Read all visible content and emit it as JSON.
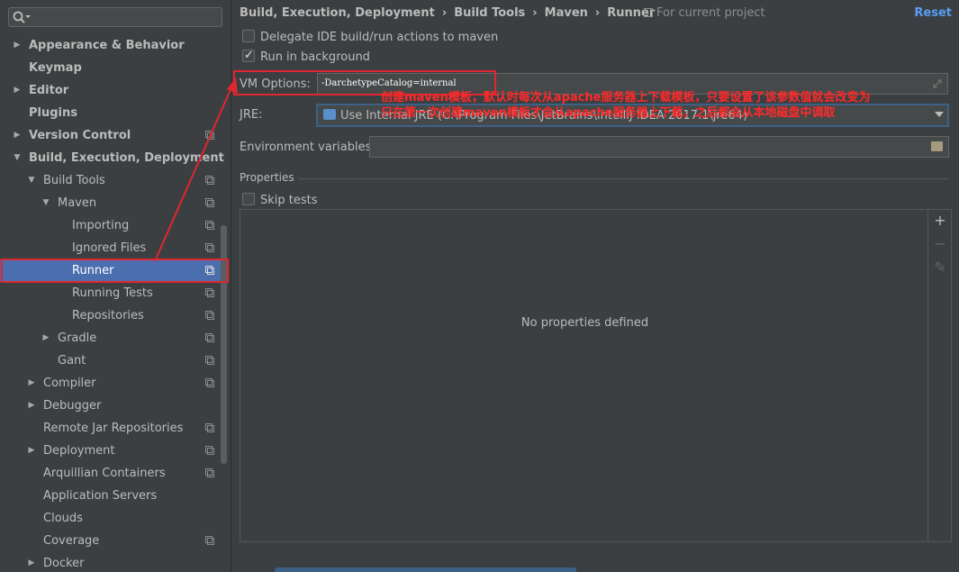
{
  "sidebar": {
    "search_placeholder": "",
    "items": [
      {
        "label": "Appearance & Behavior",
        "bold": true,
        "indent": 0,
        "arrow": "right",
        "scope": false
      },
      {
        "label": "Keymap",
        "bold": true,
        "indent": 0,
        "arrow": "",
        "scope": false
      },
      {
        "label": "Editor",
        "bold": true,
        "indent": 0,
        "arrow": "right",
        "scope": false
      },
      {
        "label": "Plugins",
        "bold": true,
        "indent": 0,
        "arrow": "",
        "scope": false
      },
      {
        "label": "Version Control",
        "bold": true,
        "indent": 0,
        "arrow": "right",
        "scope": true
      },
      {
        "label": "Build, Execution, Deployment",
        "bold": true,
        "indent": 0,
        "arrow": "down",
        "scope": false
      },
      {
        "label": "Build Tools",
        "bold": false,
        "indent": 1,
        "arrow": "down",
        "scope": true
      },
      {
        "label": "Maven",
        "bold": false,
        "indent": 2,
        "arrow": "down",
        "scope": true
      },
      {
        "label": "Importing",
        "bold": false,
        "indent": 3,
        "arrow": "",
        "scope": true
      },
      {
        "label": "Ignored Files",
        "bold": false,
        "indent": 3,
        "arrow": "",
        "scope": true
      },
      {
        "label": "Runner",
        "bold": false,
        "indent": 3,
        "arrow": "",
        "scope": true,
        "selected": true
      },
      {
        "label": "Running Tests",
        "bold": false,
        "indent": 3,
        "arrow": "",
        "scope": true
      },
      {
        "label": "Repositories",
        "bold": false,
        "indent": 3,
        "arrow": "",
        "scope": true
      },
      {
        "label": "Gradle",
        "bold": false,
        "indent": 2,
        "arrow": "right",
        "scope": true
      },
      {
        "label": "Gant",
        "bold": false,
        "indent": 2,
        "arrow": "",
        "scope": true
      },
      {
        "label": "Compiler",
        "bold": false,
        "indent": 1,
        "arrow": "right",
        "scope": true
      },
      {
        "label": "Debugger",
        "bold": false,
        "indent": 1,
        "arrow": "right",
        "scope": false
      },
      {
        "label": "Remote Jar Repositories",
        "bold": false,
        "indent": 1,
        "arrow": "",
        "scope": true
      },
      {
        "label": "Deployment",
        "bold": false,
        "indent": 1,
        "arrow": "right",
        "scope": true
      },
      {
        "label": "Arquillian Containers",
        "bold": false,
        "indent": 1,
        "arrow": "",
        "scope": true
      },
      {
        "label": "Application Servers",
        "bold": false,
        "indent": 1,
        "arrow": "",
        "scope": false
      },
      {
        "label": "Clouds",
        "bold": false,
        "indent": 1,
        "arrow": "",
        "scope": false
      },
      {
        "label": "Coverage",
        "bold": false,
        "indent": 1,
        "arrow": "",
        "scope": true
      },
      {
        "label": "Docker",
        "bold": false,
        "indent": 1,
        "arrow": "right",
        "scope": false
      }
    ]
  },
  "breadcrumb": [
    "Build, Execution, Deployment",
    "Build Tools",
    "Maven",
    "Runner"
  ],
  "breadcrumb_separator": "›",
  "for_project": "For current project",
  "reset_label": "Reset",
  "options": {
    "delegate": {
      "label": "Delegate IDE build/run actions to maven",
      "checked": false
    },
    "background": {
      "label": "Run in background",
      "checked": true
    },
    "skip_tests": {
      "label": "Skip tests",
      "checked": false
    }
  },
  "vm_options": {
    "label": "VM Options:",
    "value": "-DarchetypeCatalog=internal"
  },
  "jre": {
    "label": "JRE:",
    "value": "Use Internal JRE (C:\\Program Files\\JetBrains\\IntelliJ IDEA 2017.1\\jre64)"
  },
  "env": {
    "label": "Environment variables:",
    "value": ""
  },
  "properties": {
    "section_label": "Properties",
    "empty_text": "No properties defined"
  },
  "toolbar": {
    "add": "+",
    "remove": "−",
    "edit": "✎"
  },
  "annotation": {
    "line1": "创建maven模板，默认时每次从apache服务器上下载模板，只要设置了该参数值就会改变为",
    "line2": "只在第一次创建maven模板才会从apache服务器上下载，之后都会从本地磁盘中调取"
  },
  "colors": {
    "accent": "#4b6eaf",
    "annotation": "#e0262f",
    "link": "#589df6"
  }
}
